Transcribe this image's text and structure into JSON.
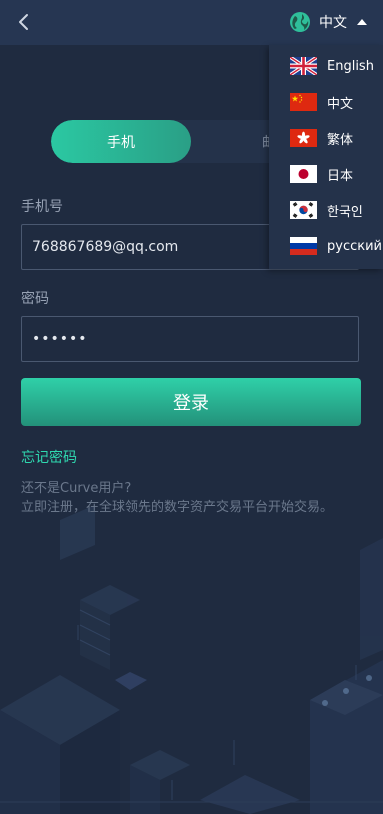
{
  "header": {
    "current_language": "中文",
    "icons": [
      "back-arrow-icon",
      "globe-icon",
      "caret-up-icon"
    ]
  },
  "tabs": {
    "active_label": "手机",
    "inactive_label": "邮箱"
  },
  "form": {
    "phone_label": "手机号",
    "phone_value": "768867689@qq.com",
    "password_label": "密码",
    "password_value": "••••••",
    "login_button": "登录",
    "forgot_password": "忘记密码",
    "not_user": "还不是Curve用户?",
    "register_hint": "立即注册，在全球领先的数字资产交易平台开始交易。"
  },
  "language_menu": {
    "items": [
      {
        "label": "English",
        "flag": "uk-flag-icon"
      },
      {
        "label": "中文",
        "flag": "china-flag-icon"
      },
      {
        "label": "繁体",
        "flag": "hongkong-flag-icon"
      },
      {
        "label": "日本",
        "flag": "japan-flag-icon"
      },
      {
        "label": "한국인",
        "flag": "korea-flag-icon"
      },
      {
        "label": "русский",
        "flag": "russia-flag-icon"
      }
    ]
  },
  "colors": {
    "background": "#1f2b40",
    "accent": "#2bc8a2",
    "link": "#2fd9b0"
  }
}
